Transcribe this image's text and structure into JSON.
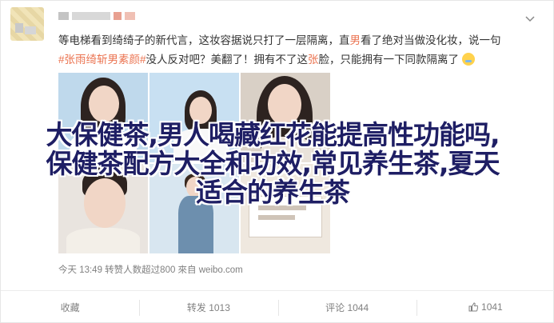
{
  "post": {
    "text_line1": "等电梯看到绮绮子的新代言，这妆容据说只打了一层隔离，直",
    "text_line1_hl": "男",
    "text_line1_tail": "看了绝对当做没化妆，说一句",
    "tag": "#张雨绮斩男素颜#",
    "text_line2_a": "没人反对吧？美翻了！拥有不了这",
    "text_line2_hl": "张",
    "text_line2_b": "脸，只能拥有一下同款隔离了",
    "meta": "今天 13:49 转赞人数超过800  來自 weibo.com"
  },
  "overlay": {
    "line1": "大保健茶,男人喝藏红花能提高性功能吗,",
    "line2": "保健茶配方大全和功效,常见养生茶,夏天",
    "line3": "适合的养生茶"
  },
  "actions": {
    "favorite": "收藏",
    "repost": "转发 1013",
    "comment": "评论 1044",
    "like": "1041"
  },
  "colors": {
    "highlight": "#eb7350",
    "overlay_text": "#1e1e64"
  }
}
